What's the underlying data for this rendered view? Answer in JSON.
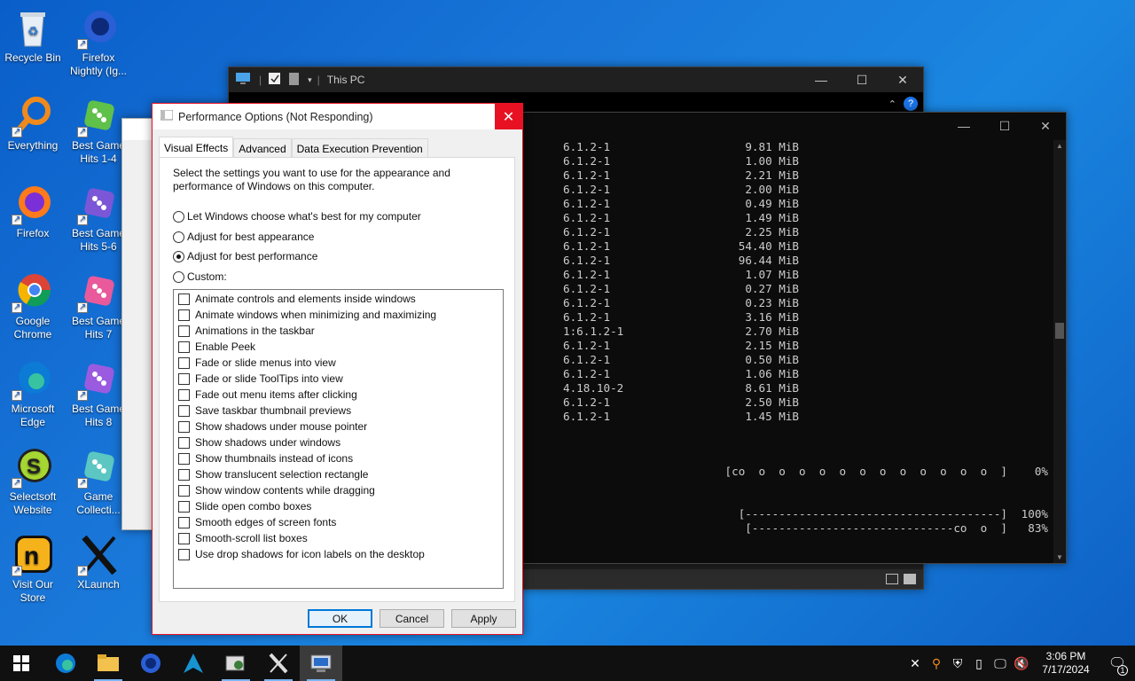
{
  "desktop": {
    "icons": [
      {
        "label": "Recycle Bin"
      },
      {
        "label": "Firefox Nightly (Ig..."
      },
      {
        "label": "Everything"
      },
      {
        "label": "Best Game Hits 1-4"
      },
      {
        "label": "Firefox"
      },
      {
        "label": "Best Game Hits 5-6"
      },
      {
        "label": "Google Chrome"
      },
      {
        "label": "Best Game Hits 7"
      },
      {
        "label": "Microsoft Edge"
      },
      {
        "label": "Best Game Hits 8"
      },
      {
        "label": "Selectsoft Website"
      },
      {
        "label": "Game Collecti..."
      },
      {
        "label": "Visit Our Store"
      },
      {
        "label": "XLaunch"
      }
    ]
  },
  "explorer": {
    "title": "This PC"
  },
  "terminal": {
    "rows": [
      {
        "version": "6.1.2-1",
        "size": "9.81 MiB"
      },
      {
        "version": "6.1.2-1",
        "size": "1.00 MiB"
      },
      {
        "version": "6.1.2-1",
        "size": "2.21 MiB"
      },
      {
        "version": "6.1.2-1",
        "size": "2.00 MiB"
      },
      {
        "version": "6.1.2-1",
        "size": "0.49 MiB"
      },
      {
        "version": "6.1.2-1",
        "size": "1.49 MiB"
      },
      {
        "version": "6.1.2-1",
        "size": "2.25 MiB"
      },
      {
        "version": "6.1.2-1",
        "size": "54.40 MiB"
      },
      {
        "version": "6.1.2-1",
        "size": "96.44 MiB"
      },
      {
        "version": "6.1.2-1",
        "size": "1.07 MiB"
      },
      {
        "version": "6.1.2-1",
        "size": "0.27 MiB"
      },
      {
        "version": "6.1.2-1",
        "size": "0.23 MiB"
      },
      {
        "version": "6.1.2-1",
        "size": "3.16 MiB"
      },
      {
        "version": "1:6.1.2-1",
        "size": "2.70 MiB"
      },
      {
        "version": "6.1.2-1",
        "size": "2.15 MiB"
      },
      {
        "version": "6.1.2-1",
        "size": "0.50 MiB"
      },
      {
        "version": "6.1.2-1",
        "size": "1.06 MiB"
      },
      {
        "version": "4.18.10-2",
        "size": "8.61 MiB"
      },
      {
        "version": "6.1.2-1",
        "size": "2.50 MiB"
      },
      {
        "version": "6.1.2-1",
        "size": "1.45 MiB"
      }
    ],
    "progress_lines": [
      {
        "bar": "[co  o  o  o  o  o  o  o  o  o  o  o  o  ]",
        "pct": "0%"
      },
      {
        "bar": "[--------------------------------------]",
        "pct": "100%"
      },
      {
        "bar": "[------------------------------co  o  ]",
        "pct": "83%"
      }
    ]
  },
  "dialog": {
    "title": "Performance Options (Not Responding)",
    "tabs": [
      "Visual Effects",
      "Advanced",
      "Data Execution Prevention"
    ],
    "description": "Select the settings you want to use for the appearance and performance of Windows on this computer.",
    "radios": [
      {
        "label": "Let Windows choose what's best for my computer",
        "checked": false
      },
      {
        "label": "Adjust for best appearance",
        "checked": false
      },
      {
        "label": "Adjust for best performance",
        "checked": true
      },
      {
        "label": "Custom:",
        "checked": false
      }
    ],
    "options": [
      "Animate controls and elements inside windows",
      "Animate windows when minimizing and maximizing",
      "Animations in the taskbar",
      "Enable Peek",
      "Fade or slide menus into view",
      "Fade or slide ToolTips into view",
      "Fade out menu items after clicking",
      "Save taskbar thumbnail previews",
      "Show shadows under mouse pointer",
      "Show shadows under windows",
      "Show thumbnails instead of icons",
      "Show translucent selection rectangle",
      "Show window contents while dragging",
      "Slide open combo boxes",
      "Smooth edges of screen fonts",
      "Smooth-scroll list boxes",
      "Use drop shadows for icon labels on the desktop"
    ],
    "buttons": {
      "ok": "OK",
      "cancel": "Cancel",
      "apply": "Apply"
    }
  },
  "taskbar": {
    "time": "3:06 PM",
    "date": "7/17/2024",
    "notification_count": "1"
  },
  "colors": {
    "desktop_blue": "#1976d8",
    "close_red": "#e81123",
    "accent": "#0078d7"
  }
}
